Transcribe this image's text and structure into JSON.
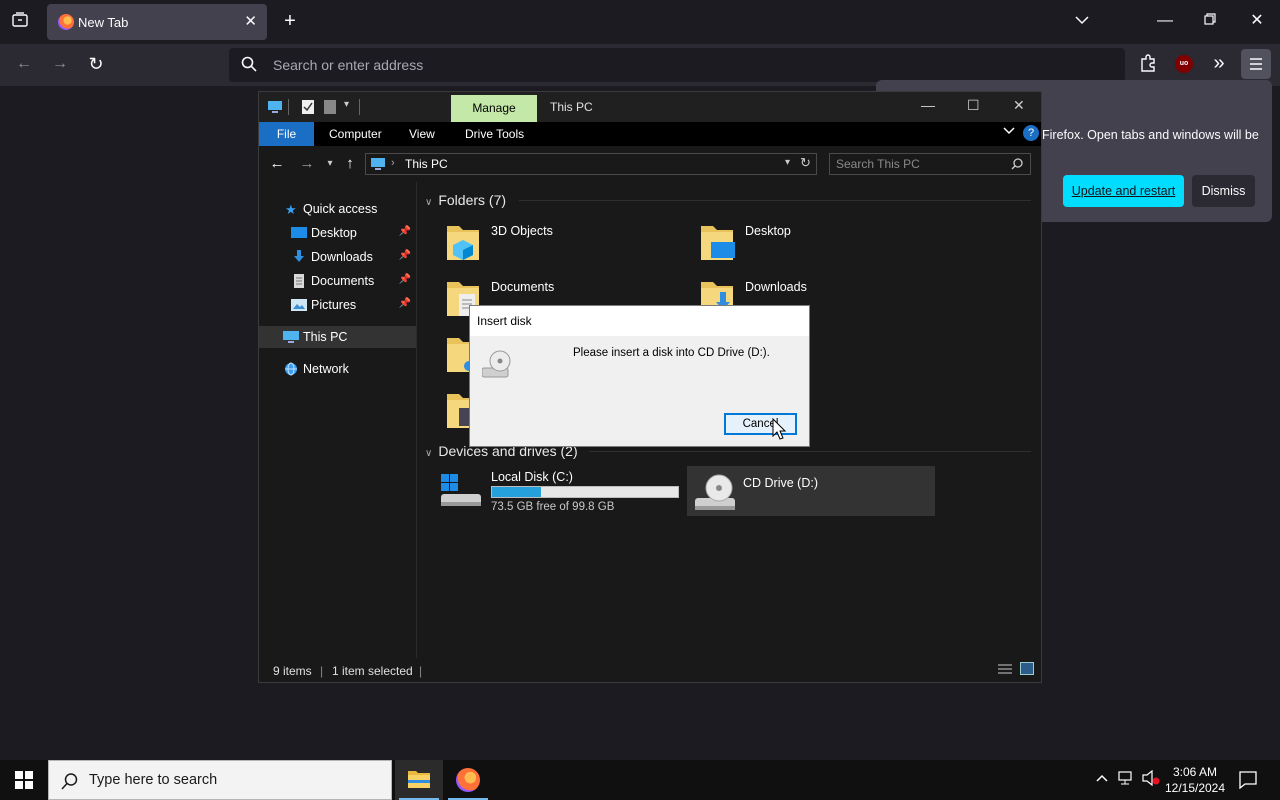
{
  "browser": {
    "tab_title": "New Tab",
    "address_placeholder": "Search or enter address",
    "update_popup": {
      "message": "Firefox. Open tabs and windows will be",
      "update_label": "Update and restart",
      "dismiss_label": "Dismiss"
    }
  },
  "explorer": {
    "ribbon_context_tab": "Manage",
    "window_title": "This PC",
    "ribbon_tabs": {
      "file": "File",
      "computer": "Computer",
      "view": "View",
      "drive_tools": "Drive Tools"
    },
    "address": "This PC",
    "search_placeholder": "Search This PC",
    "nav": {
      "quick_access": "Quick access",
      "desktop": "Desktop",
      "downloads": "Downloads",
      "documents": "Documents",
      "pictures": "Pictures",
      "this_pc": "This PC",
      "network": "Network"
    },
    "folders_header": "Folders (7)",
    "folders": [
      "3D Objects",
      "Desktop",
      "Documents",
      "Downloads"
    ],
    "devices_header": "Devices and drives (2)",
    "drives": [
      {
        "name": "Local Disk (C:)",
        "free_text": "73.5 GB free of 99.8 GB",
        "used_fraction": 0.264
      },
      {
        "name": "CD Drive (D:)"
      }
    ],
    "status": {
      "items": "9 items",
      "selected": "1 item selected"
    }
  },
  "dialog": {
    "title": "Insert disk",
    "message": "Please insert a disk into CD Drive (D:).",
    "cancel_label": "Cancel"
  },
  "taskbar": {
    "search_placeholder": "Type here to search",
    "time": "3:06 AM",
    "date": "12/15/2024"
  },
  "colors": {
    "accent": "#00ddff",
    "manage_tab": "#c3e8a7",
    "file_tab": "#1a6fc4",
    "drive_fill": "#26a0da"
  }
}
